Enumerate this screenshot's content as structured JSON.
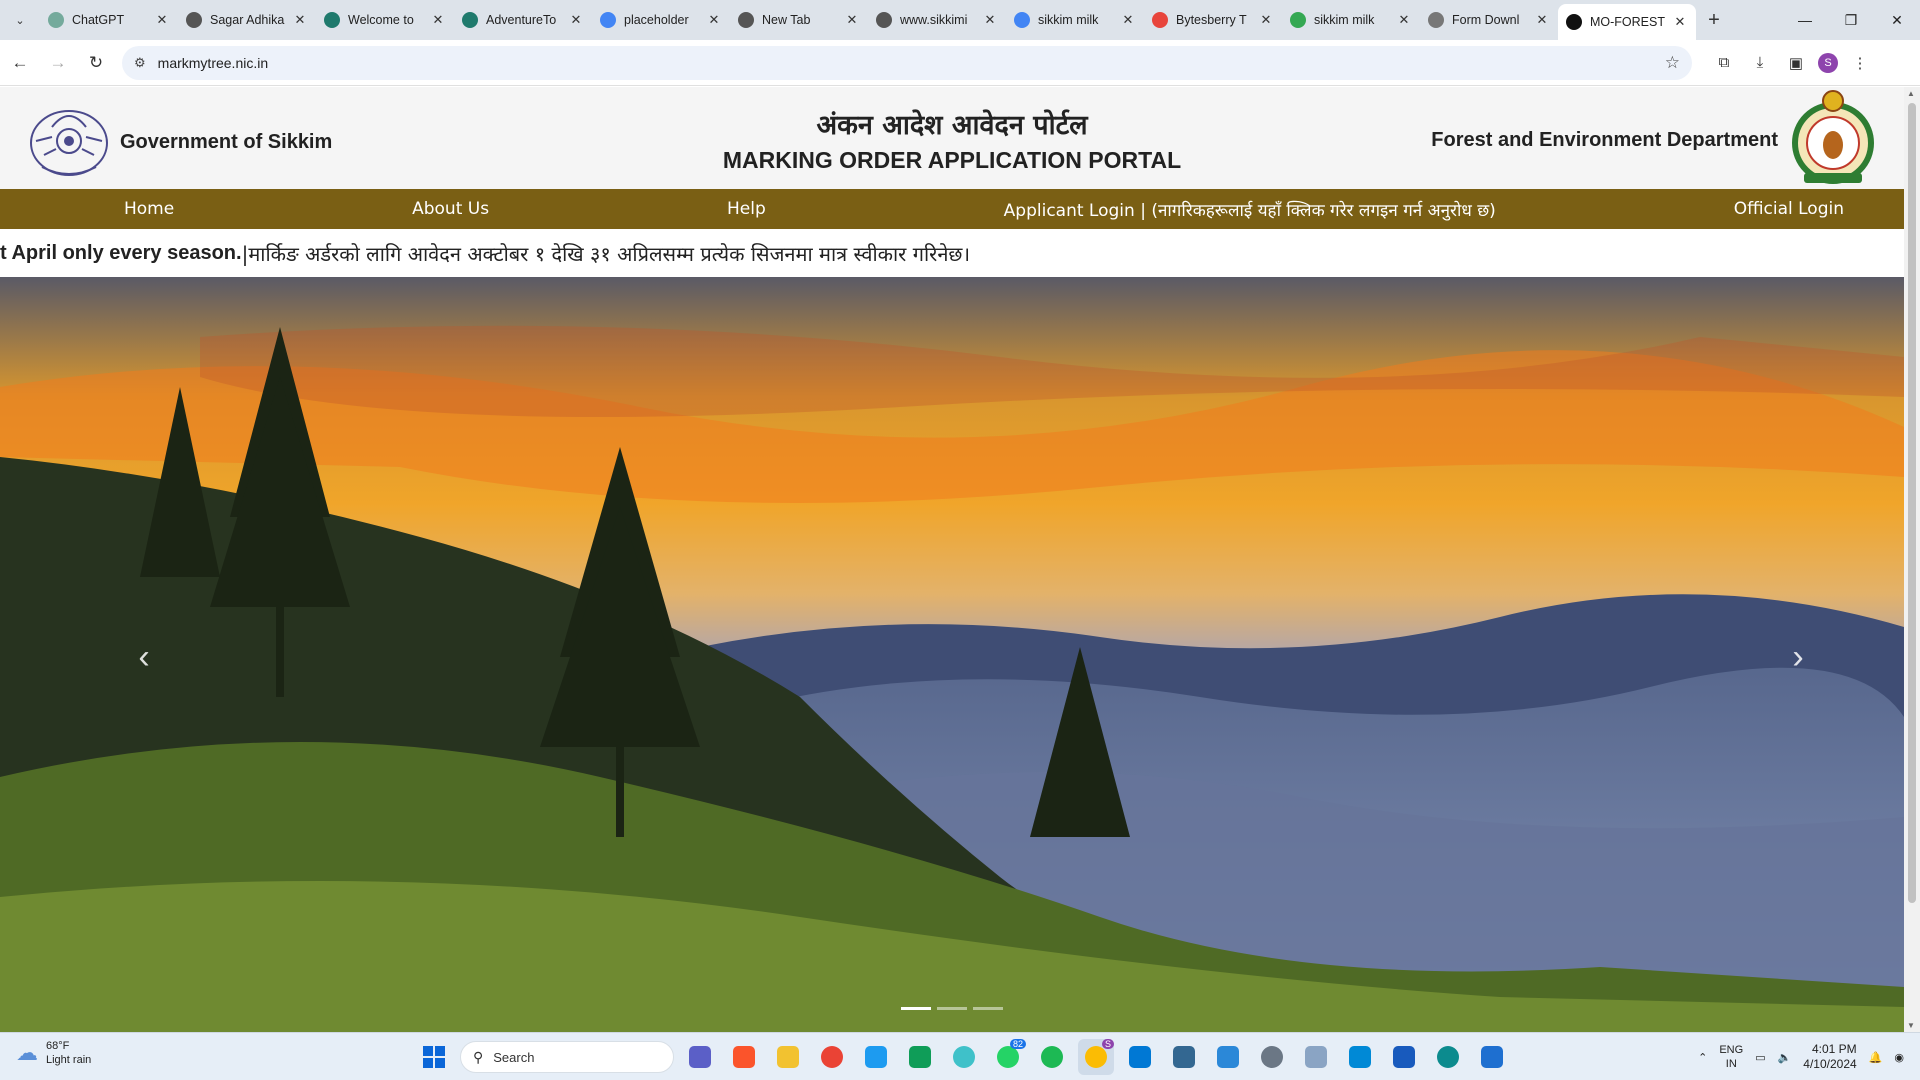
{
  "browser": {
    "tabs": [
      {
        "title": "ChatGPT",
        "color": "#74aa9c"
      },
      {
        "title": "Sagar Adhika",
        "color": "#555555"
      },
      {
        "title": "Welcome to",
        "color": "#1f7a6d"
      },
      {
        "title": "AdventureTo",
        "color": "#1f7a6d"
      },
      {
        "title": "placeholder",
        "color": "#4285f4"
      },
      {
        "title": "New Tab",
        "color": "#555555"
      },
      {
        "title": "www.sikkimi",
        "color": "#555555"
      },
      {
        "title": "sikkim milk",
        "color": "#4285f4"
      },
      {
        "title": "Bytesberry T",
        "color": "#e8453c"
      },
      {
        "title": "sikkim milk",
        "color": "#34a853"
      },
      {
        "title": "Form Downl",
        "color": "#777777"
      },
      {
        "title": "MO-FOREST",
        "color": "#111111",
        "active": true
      }
    ],
    "url": "markmytree.nic.in",
    "profile_initial": "S"
  },
  "site": {
    "gov_name": "Government of Sikkim",
    "title_np": "अंकन आदेश आवेदन पोर्टल",
    "title_en": "MARKING ORDER APPLICATION PORTAL",
    "dept_name": "Forest and Environment Department",
    "nav": {
      "home": "Home",
      "about": "About Us",
      "help": "Help",
      "applicant_login": "Applicant Login | (नागरिकहरूलाई यहाँ क्लिक गरेर लगइन गर्न अनुरोध छ)",
      "official_login": "Official Login"
    },
    "marquee": {
      "en": "t April only every season.",
      "np": "|मार्किङ अर्डरको लागि आवेदन अक्टोबर १ देखि ३१ अप्रिलसम्म प्रत्येक सिजनमा मात्र स्वीकार गरिनेछ।"
    },
    "carousel": {
      "slide_count": 3,
      "active_slide": 1
    }
  },
  "taskbar": {
    "weather_temp": "68°F",
    "weather_desc": "Light rain",
    "search_placeholder": "Search",
    "whatsapp_badge": "82",
    "chrome_badge": "S",
    "lang_top": "ENG",
    "lang_bottom": "IN",
    "time": "4:01 PM",
    "date": "4/10/2024"
  }
}
